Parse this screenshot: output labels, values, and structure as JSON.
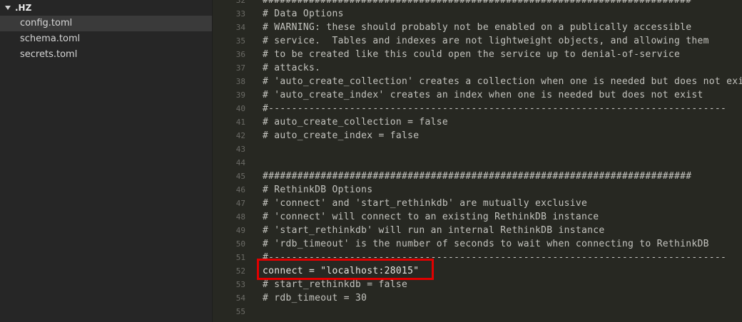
{
  "sidebar": {
    "folder": ".HZ",
    "files": [
      {
        "name": "config.toml",
        "selected": true
      },
      {
        "name": "schema.toml",
        "selected": false
      },
      {
        "name": "secrets.toml",
        "selected": false
      }
    ]
  },
  "editor": {
    "lines": [
      {
        "n": "32",
        "text": "##########################################################################"
      },
      {
        "n": "33",
        "text": "# Data Options"
      },
      {
        "n": "34",
        "text": "# WARNING: these should probably not be enabled on a publically accessible"
      },
      {
        "n": "35",
        "text": "# service.  Tables and indexes are not lightweight objects, and allowing them"
      },
      {
        "n": "36",
        "text": "# to be created like this could open the service up to denial-of-service"
      },
      {
        "n": "37",
        "text": "# attacks."
      },
      {
        "n": "38",
        "text": "# 'auto_create_collection' creates a collection when one is needed but does not exist"
      },
      {
        "n": "39",
        "text": "# 'auto_create_index' creates an index when one is needed but does not exist"
      },
      {
        "n": "40",
        "text": "#-------------------------------------------------------------------------------"
      },
      {
        "n": "41",
        "text": "# auto_create_collection = false"
      },
      {
        "n": "42",
        "text": "# auto_create_index = false"
      },
      {
        "n": "43",
        "text": ""
      },
      {
        "n": "44",
        "text": ""
      },
      {
        "n": "45",
        "text": "##########################################################################"
      },
      {
        "n": "46",
        "text": "# RethinkDB Options"
      },
      {
        "n": "47",
        "text": "# 'connect' and 'start_rethinkdb' are mutually exclusive"
      },
      {
        "n": "48",
        "text": "# 'connect' will connect to an existing RethinkDB instance"
      },
      {
        "n": "49",
        "text": "# 'start_rethinkdb' will run an internal RethinkDB instance"
      },
      {
        "n": "50",
        "text": "# 'rdb_timeout' is the number of seconds to wait when connecting to RethinkDB"
      },
      {
        "n": "51",
        "text": "#-------------------------------------------------------------------------------"
      },
      {
        "n": "52",
        "text": "connect = \"localhost:28015\""
      },
      {
        "n": "53",
        "text": "# start_rethinkdb = false"
      },
      {
        "n": "54",
        "text": "# rdb_timeout = 30"
      },
      {
        "n": "55",
        "text": ""
      }
    ]
  }
}
